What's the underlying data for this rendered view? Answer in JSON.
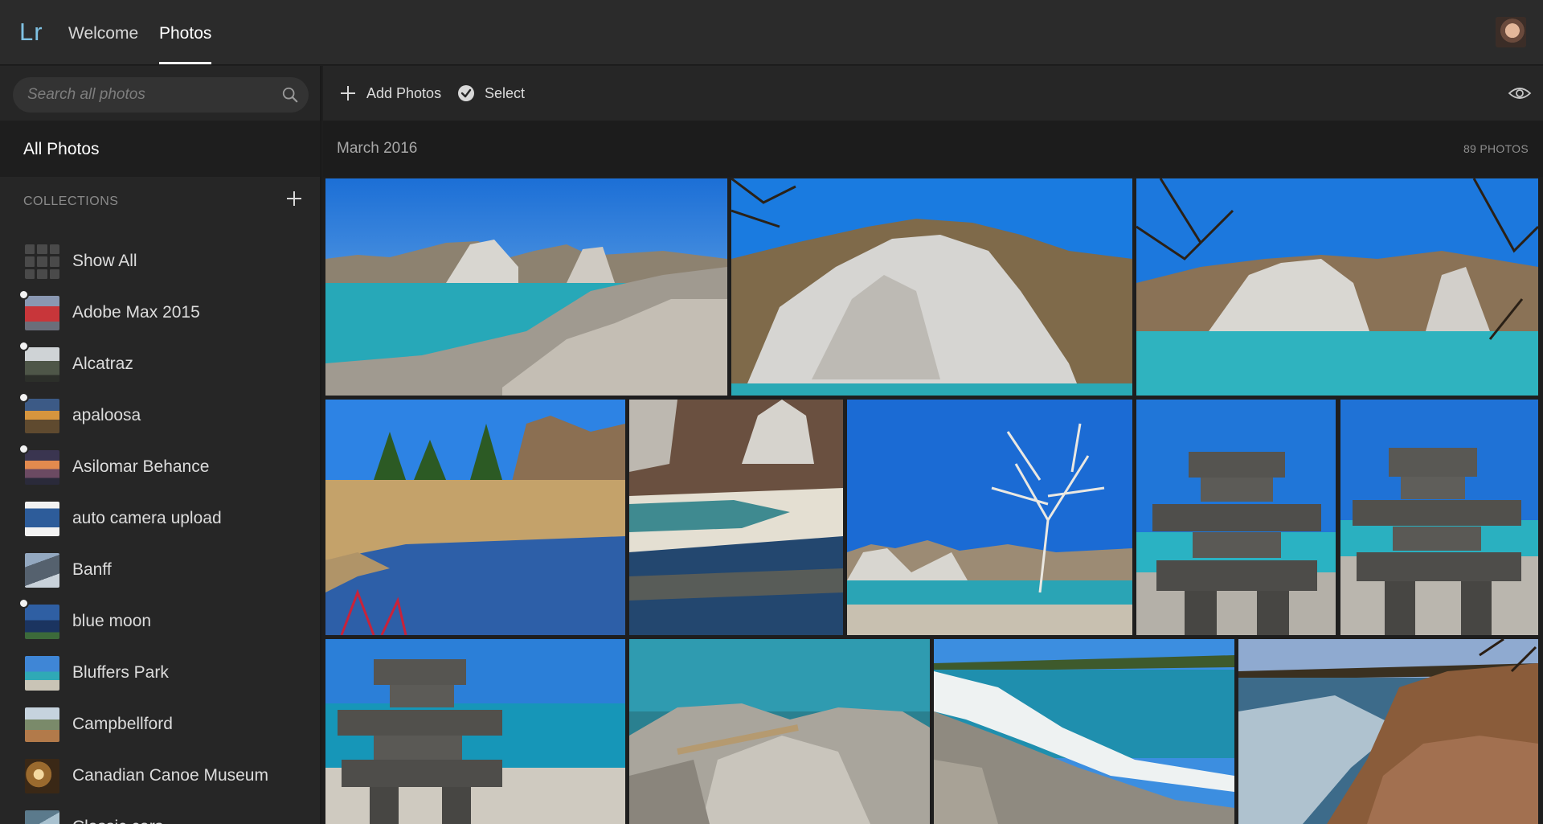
{
  "app": {
    "logo": "Lr",
    "tabs": [
      {
        "label": "Welcome",
        "active": false
      },
      {
        "label": "Photos",
        "active": true
      }
    ]
  },
  "sidebar": {
    "search_placeholder": "Search all photos",
    "all_photos_label": "All Photos",
    "collections_heading": "COLLECTIONS",
    "collections": [
      {
        "label": "Show All",
        "shared": false
      },
      {
        "label": "Adobe Max 2015",
        "shared": true
      },
      {
        "label": "Alcatraz",
        "shared": true
      },
      {
        "label": "apaloosa",
        "shared": true
      },
      {
        "label": "Asilomar Behance",
        "shared": true
      },
      {
        "label": "auto camera upload",
        "shared": false
      },
      {
        "label": "Banff",
        "shared": false
      },
      {
        "label": "blue moon",
        "shared": true
      },
      {
        "label": "Bluffers Park",
        "shared": false
      },
      {
        "label": "Campbellford",
        "shared": false
      },
      {
        "label": "Canadian Canoe Museum",
        "shared": false
      },
      {
        "label": "Classic cars",
        "shared": false
      }
    ]
  },
  "toolbar": {
    "add_photos_label": "Add Photos",
    "select_label": "Select"
  },
  "section": {
    "month": "March 2016",
    "count": "89 PHOTOS"
  },
  "colors": {
    "accent_logo": "#7fc1e2",
    "background": "#1e1e1e",
    "panel": "#262626"
  }
}
